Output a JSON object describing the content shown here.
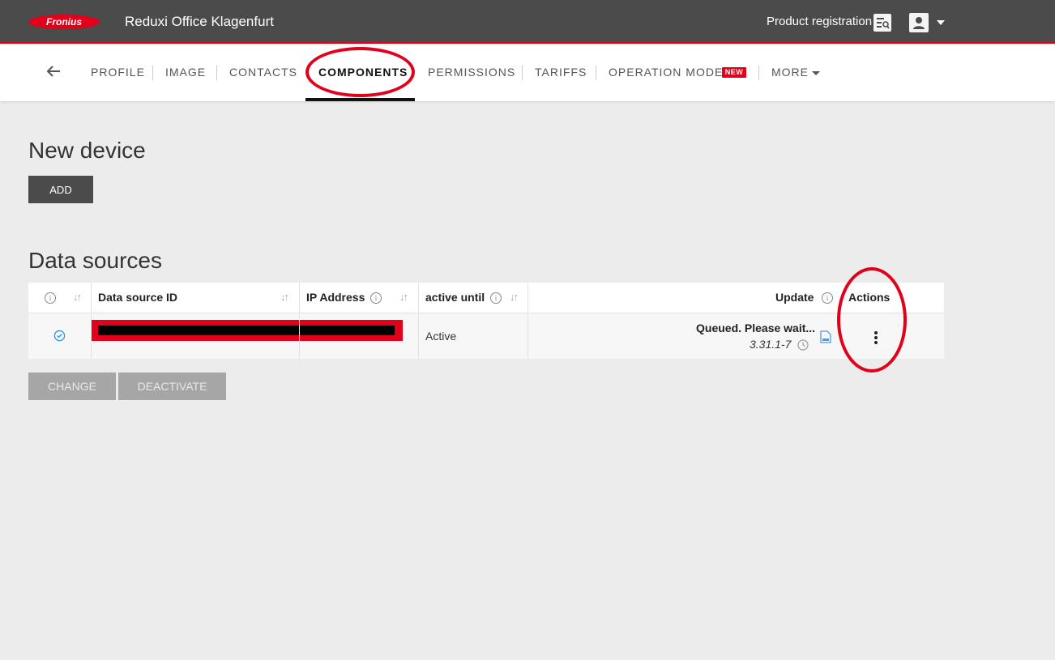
{
  "header": {
    "logo_text": "Fronius",
    "site_title": "Reduxi Office Klagenfurt",
    "product_registration": "Product registration",
    "brand_color": "#e2001a",
    "bar_color": "#4b4b4b"
  },
  "tabs": {
    "items": [
      {
        "label": "PROFILE"
      },
      {
        "label": "IMAGE"
      },
      {
        "label": "CONTACTS"
      },
      {
        "label": "COMPONENTS",
        "active": true
      },
      {
        "label": "PERMISSIONS"
      },
      {
        "label": "TARIFFS"
      },
      {
        "label": "OPERATION MODE"
      },
      {
        "label": "MORE"
      }
    ],
    "new_badge": "NEW"
  },
  "new_device": {
    "title": "New device",
    "add_label": "ADD"
  },
  "data_sources": {
    "title": "Data sources",
    "columns": {
      "id": "Data source ID",
      "ip": "IP Address",
      "active_until": "active until",
      "update": "Update",
      "actions": "Actions"
    },
    "rows": [
      {
        "status": "selected",
        "active_until": "Active",
        "update_status": "Queued. Please wait...",
        "version": "3.31.1-7"
      }
    ],
    "change_label": "CHANGE",
    "deactivate_label": "DEACTIVATE"
  },
  "icons": {
    "back": "arrow-left-icon",
    "registration": "registration-card-icon",
    "user": "account-icon",
    "info": "info-icon",
    "sort": "sort-icon",
    "check": "check-circle-icon",
    "clock": "clock-icon",
    "file": "file-icon",
    "kebab": "more-vert-icon"
  }
}
